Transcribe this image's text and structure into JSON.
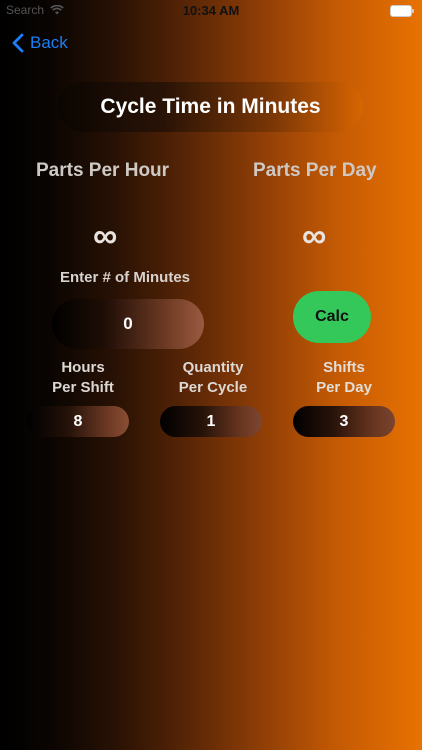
{
  "status_bar": {
    "carrier": "Search",
    "time": "10:34 AM"
  },
  "nav": {
    "back_label": "Back"
  },
  "title": "Cycle Time in Minutes",
  "results": {
    "parts_per_hour_label": "Parts Per Hour",
    "parts_per_hour_value": "∞",
    "parts_per_day_label": "Parts Per Day",
    "parts_per_day_value": "∞"
  },
  "minutes": {
    "label": "Enter # of Minutes",
    "value": "0"
  },
  "calc_button": "Calc",
  "hours_per_shift": {
    "label_line1": "Hours",
    "label_line2": "Per Shift",
    "value": "8"
  },
  "quantity_per_cycle": {
    "label_line1": "Quantity",
    "label_line2": "Per Cycle",
    "value": "1"
  },
  "shifts_per_day": {
    "label_line1": "Shifts",
    "label_line2": "Per Day",
    "value": "3"
  },
  "colors": {
    "accent_blue": "#1a7ef5",
    "calc_green": "#34c759",
    "orange": "#e87202"
  }
}
